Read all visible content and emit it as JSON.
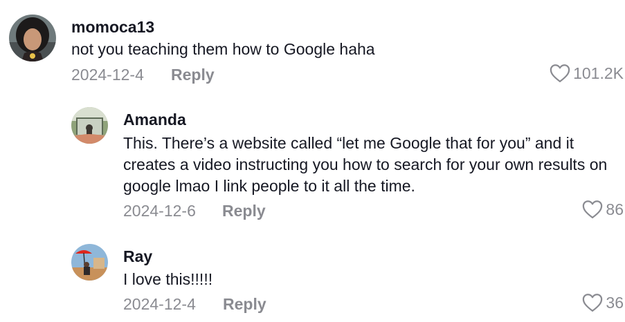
{
  "comments": [
    {
      "username": "momoca13",
      "text": "not you teaching them how to Google haha",
      "date": "2024-12-4",
      "reply_label": "Reply",
      "likes": "101.2K"
    },
    {
      "username": "Amanda",
      "text": "This. There’s a website called “let me Google that for you” and it creates a video instructing you how to search for your own results on google lmao I link people to it all the time.",
      "date": "2024-12-6",
      "reply_label": "Reply",
      "likes": "86"
    },
    {
      "username": "Ray",
      "text": "I love this!!!!!",
      "date": "2024-12-4",
      "reply_label": "Reply",
      "likes": "36"
    }
  ],
  "icons": {
    "like": "heart-outline-icon"
  },
  "colors": {
    "text_primary": "#161823",
    "text_secondary": "#8a8b91"
  }
}
